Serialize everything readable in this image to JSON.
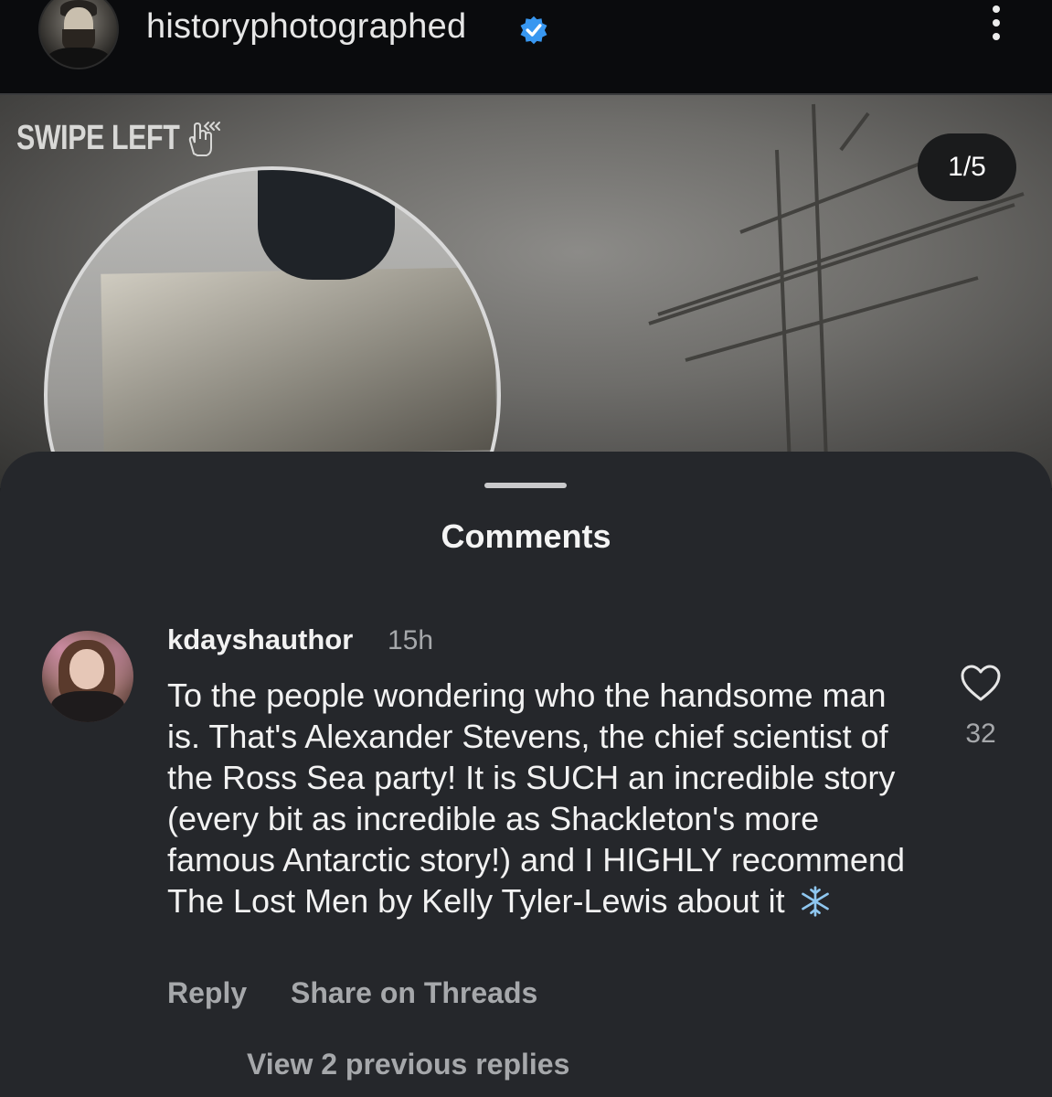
{
  "header": {
    "username": "historyphotographed",
    "verified_icon": "verified-badge-icon",
    "menu_icon": "more-vertical-icon"
  },
  "post": {
    "overlay_text": "SWIPE LEFT",
    "swipe_icon": "hand-swipe-icon",
    "counter": "1/5"
  },
  "comments_sheet": {
    "title": "Comments",
    "comment": {
      "username": "kdayshauthor",
      "time": "15h",
      "text": "To the people wondering who the handsome man is. That's Alexander Stevens, the chief scientist of the Ross Sea party! It is SUCH an incredible story (every bit as incredible as Shackleton's more famous Antarctic story!) and I HIGHLY recommend The Lost Men by Kelly Tyler-Lewis about it",
      "emoji_icon": "snowflake-icon",
      "like_count": "32",
      "reply_label": "Reply",
      "share_label": "Share on Threads",
      "view_replies_label": "View 2 previous replies"
    }
  },
  "colors": {
    "sheet_bg": "#25272b",
    "verified_blue": "#3897f0",
    "muted_text": "#a6a8ab"
  }
}
